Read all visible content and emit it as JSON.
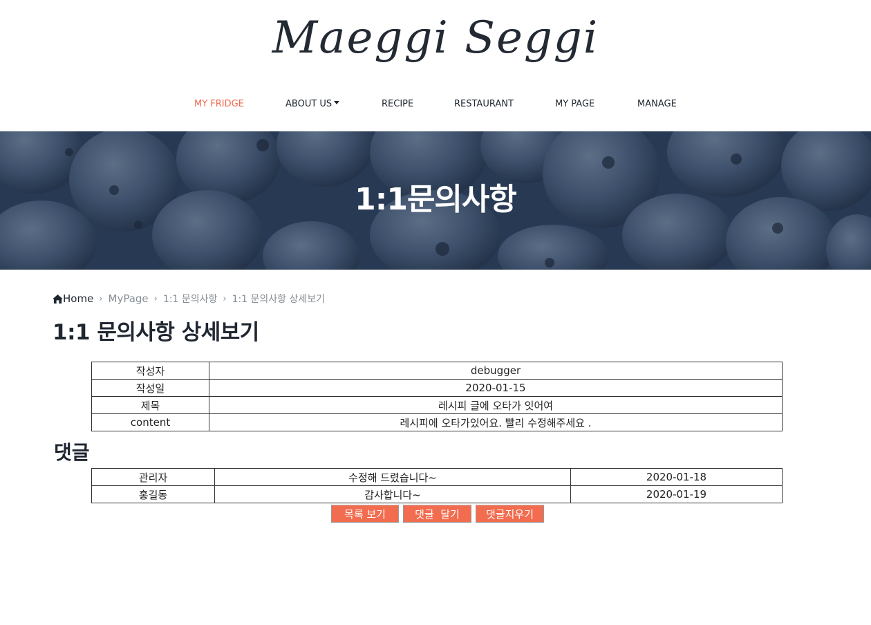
{
  "brand": {
    "logo": "Maeggi Seggi"
  },
  "nav": {
    "items": [
      {
        "label": "MY FRIDGE",
        "active": true
      },
      {
        "label": "ABOUT US",
        "dropdown": true
      },
      {
        "label": "RECIPE"
      },
      {
        "label": "RESTAURANT"
      },
      {
        "label": "MY PAGE"
      },
      {
        "label": "MANAGE"
      }
    ]
  },
  "hero": {
    "title": "1:1문의사항"
  },
  "breadcrumb": {
    "home_icon": "home-icon",
    "items": [
      "Home",
      "MyPage",
      "1:1 문의사항",
      "1:1 문의사항 상세보기"
    ]
  },
  "page": {
    "title": "1:1 문의사항 상세보기"
  },
  "detail": {
    "rows": [
      {
        "label": "작성자",
        "value": "debugger"
      },
      {
        "label": "작성일",
        "value": "2020-01-15"
      },
      {
        "label": "제목",
        "value": "레시피 글에 오타가 잇어여"
      },
      {
        "label": "content",
        "value": "레시피에 오타가있어요. 빨리 수정해주세요 ."
      }
    ]
  },
  "comments": {
    "heading": "댓글",
    "rows": [
      {
        "author": "관리자",
        "content": "수정해 드렸습니다~",
        "date": "2020-01-18"
      },
      {
        "author": "홍길동",
        "content": "감사합니다~",
        "date": "2020-01-19"
      }
    ]
  },
  "buttons": {
    "list": "목록 보기",
    "add_comment": "댓글  달기",
    "delete_comment": "댓글지우기"
  },
  "colors": {
    "accent": "#f26c4f",
    "nav_active": "#f06a4d",
    "hero_bg": "#3a4f6c",
    "text_dark": "#1f2630"
  }
}
